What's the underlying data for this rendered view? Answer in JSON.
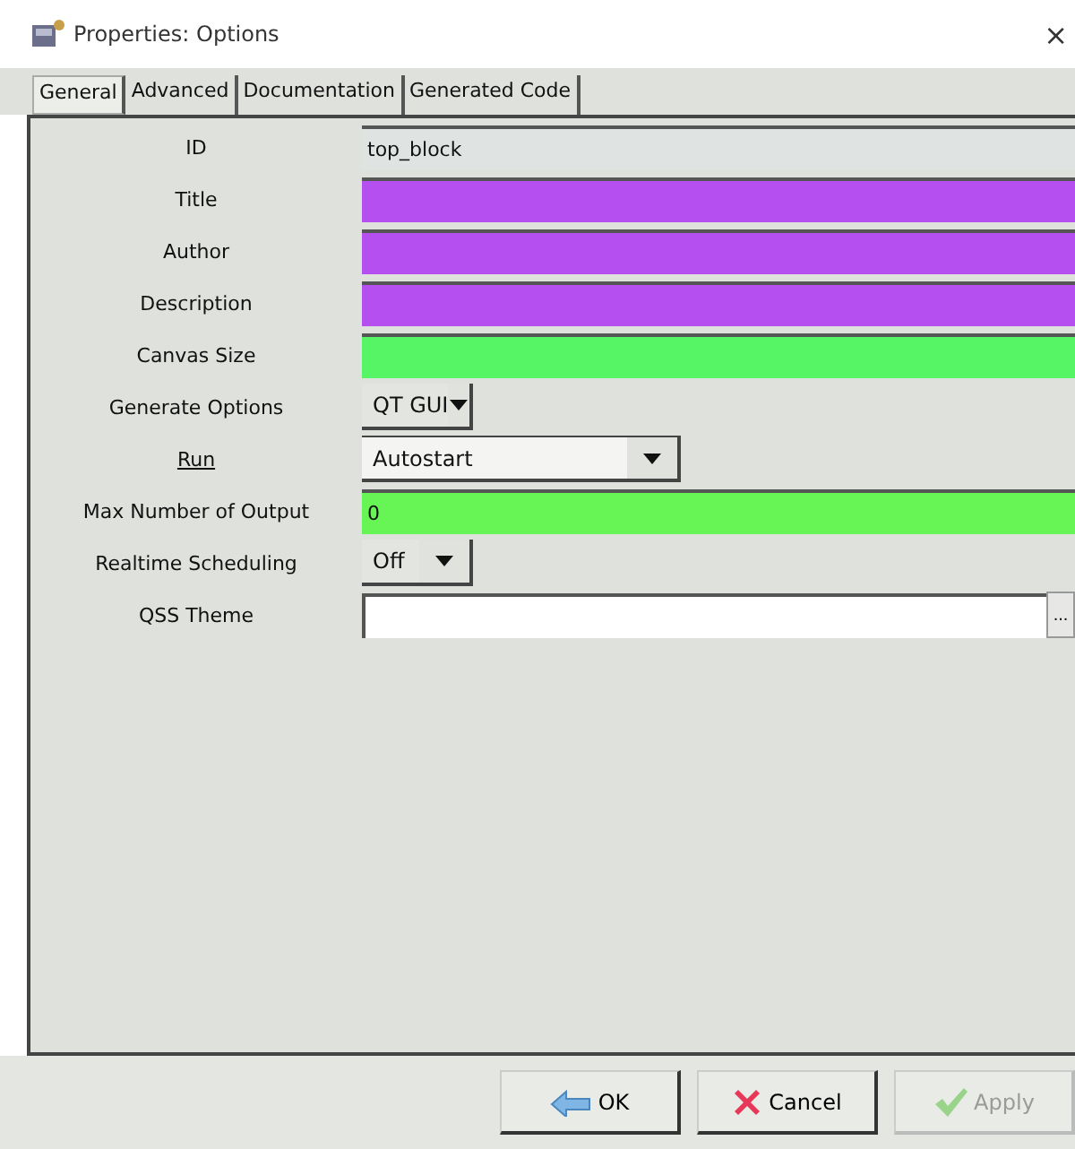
{
  "window": {
    "title": "Properties: Options",
    "close": "×"
  },
  "tabs": [
    {
      "label": "General",
      "selected": true
    },
    {
      "label": "Advanced",
      "selected": false
    },
    {
      "label": "Documentation",
      "selected": false
    },
    {
      "label": "Generated Code",
      "selected": false
    }
  ],
  "properties": [
    {
      "label": "ID",
      "kind": "field",
      "value": "top_block",
      "color": "#dfe4e3"
    },
    {
      "label": "Title",
      "kind": "field",
      "color": "#b54ff0"
    },
    {
      "label": "Author",
      "kind": "field",
      "color": "#b54ff0"
    },
    {
      "label": "Description",
      "kind": "field",
      "color": "#b54ff0"
    },
    {
      "label": "Canvas Size",
      "kind": "field",
      "color": "#55f565"
    },
    {
      "label": "Generate Options",
      "kind": "dropdown",
      "value": "QT GUI",
      "editable": false
    },
    {
      "label": "Run",
      "kind": "dropdown",
      "value": "Autostart",
      "editable": true,
      "underlined": true
    },
    {
      "label": "Max Number of Output",
      "kind": "field",
      "value": "0",
      "color": "#66f554"
    },
    {
      "label": "Realtime Scheduling",
      "kind": "dropdown",
      "value": "Off",
      "editable": false
    },
    {
      "label": "QSS Theme",
      "kind": "file",
      "color": "#ffffff",
      "browse": "..."
    }
  ],
  "buttons": [
    {
      "label": "OK",
      "kind": "ok",
      "disabled": false
    },
    {
      "label": "Cancel",
      "kind": "cancel",
      "disabled": false
    },
    {
      "label": "Apply",
      "kind": "apply",
      "disabled": true
    }
  ]
}
